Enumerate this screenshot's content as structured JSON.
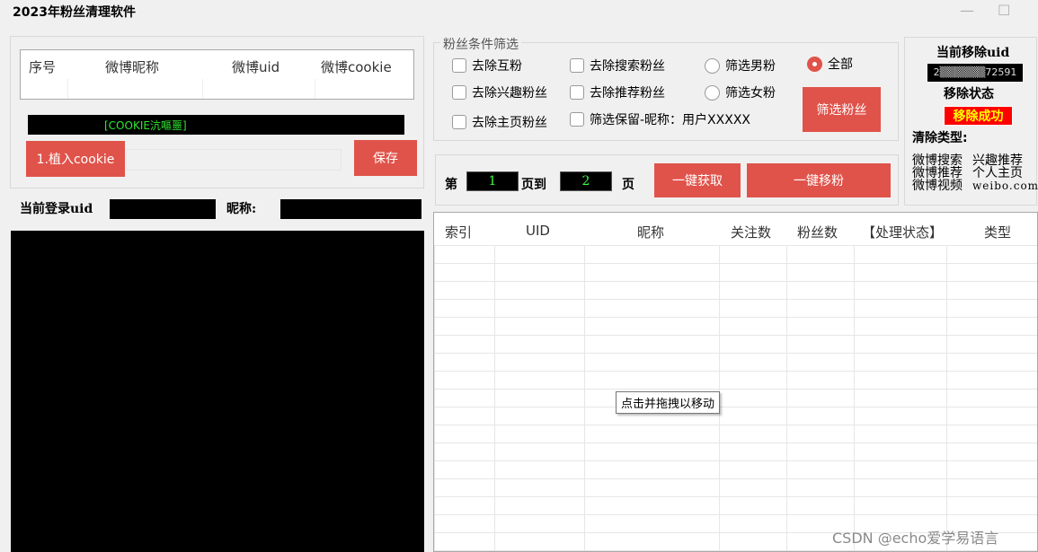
{
  "window": {
    "title": "2023年粉丝清理软件",
    "minimize": "—",
    "maximize": "☐"
  },
  "account_list": {
    "columns": [
      "序号",
      "微博昵称",
      "微博uid",
      "微博cookie"
    ]
  },
  "cookie_input": {
    "value": "[COOKIE沆嘔噩]"
  },
  "buttons": {
    "plant_cookie": "1.植入cookie",
    "save": "保存",
    "filter_fans": "筛选粉丝",
    "fetch": "一键获取",
    "remove": "一键移粉"
  },
  "login": {
    "uid_label": "当前登录uid",
    "nickname_label": "昵称:"
  },
  "filter_group": {
    "legend": "粉丝条件筛选",
    "options": [
      "去除互粉",
      "去除搜索粉丝",
      "去除兴趣粉丝",
      "去除推荐粉丝",
      "去除主页粉丝",
      "筛选保留-昵称：用户XXXXX"
    ],
    "gender": [
      "筛选男粉",
      "筛选女粉",
      "全部"
    ]
  },
  "paging": {
    "prefix": "第",
    "from_page": "1",
    "mid": "页到",
    "to_page": "2",
    "suffix": "页"
  },
  "status_panel": {
    "current_uid_label": "当前移除uid",
    "current_uid_value": "2▒▒▒▒▒▒72591",
    "status_label": "移除状态",
    "status_value": "移除成功",
    "clear_type_label": "清除类型:",
    "types_left": [
      "微博搜索",
      "微博推荐",
      "微博视频"
    ],
    "types_right": [
      "兴趣推荐",
      "个人主页",
      "weibo.com"
    ]
  },
  "result_table": {
    "columns": [
      "索引",
      "UID",
      "昵称",
      "关注数",
      "粉丝数",
      "【处理状态】",
      "类型"
    ]
  },
  "tooltip": "点击并拖拽以移动",
  "watermark": "CSDN @echo爱学易语言",
  "colors": {
    "accent_red": "#e0534a",
    "status_bg": "#ff0000",
    "status_text": "#ffff00",
    "page_text": "#3cff3c"
  }
}
